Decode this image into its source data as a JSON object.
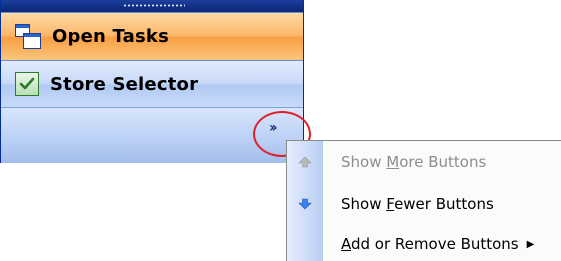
{
  "nav_pane": {
    "buttons": [
      {
        "label": "Open Tasks",
        "icon": "open-tasks-icon",
        "state": "selected"
      },
      {
        "label": "Store Selector",
        "icon": "store-selector-icon",
        "state": "normal"
      }
    ],
    "overflow_icon": "chevron-double-right-icon",
    "annotation": {
      "color": "#e0202a"
    }
  },
  "context_menu": {
    "items": [
      {
        "pre": "Show ",
        "accel": "M",
        "post": "ore Buttons",
        "icon": "arrow-up-icon",
        "enabled": false
      },
      {
        "pre": "Show ",
        "accel": "F",
        "post": "ewer Buttons",
        "icon": "arrow-down-icon",
        "enabled": true
      },
      {
        "pre": "",
        "accel": "A",
        "post": "dd or Remove Buttons",
        "icon": "",
        "enabled": true,
        "submenu": true
      }
    ]
  },
  "colors": {
    "selected_button": "#f89e42",
    "normal_button": "#c6d8f8",
    "frame": "#002d96"
  }
}
